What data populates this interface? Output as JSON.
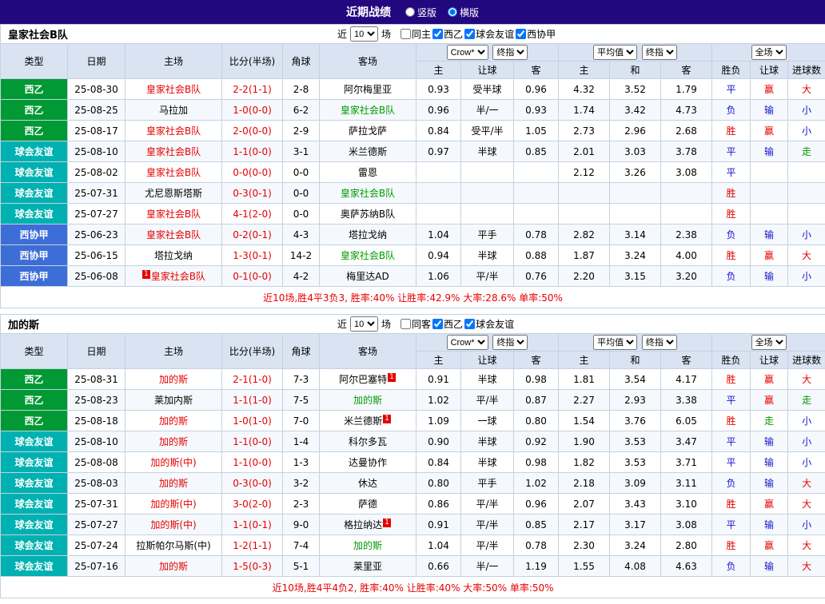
{
  "topbar": {
    "title": "近期战绩",
    "options": [
      {
        "label": "竖版",
        "selected": false
      },
      {
        "label": "横版",
        "selected": true
      }
    ]
  },
  "colors": {
    "topbar_bg": "#23077e",
    "header_bg": "#d9e3f2",
    "border": "#c4d2e0",
    "score_red": "#e60000",
    "result_blue": "#1414cc",
    "result_green": "#009900",
    "league": {
      "西乙": "#009933",
      "球会友谊": "#00b1b1",
      "西协甲": "#3d6dd6"
    }
  },
  "tables": [
    {
      "team": "皇家社会B队",
      "filter": {
        "prefix": "近",
        "count": "10",
        "suffix": "场",
        "checkboxes": [
          {
            "label": "同主",
            "checked": false
          },
          {
            "label": "西乙",
            "checked": true
          },
          {
            "label": "球会友谊",
            "checked": true
          },
          {
            "label": "西协甲",
            "checked": true
          }
        ]
      },
      "selects": {
        "bookmaker": "Crow*",
        "asia_time": "终指",
        "europe_avg": "平均值",
        "europe_time": "终指",
        "scope": "全场"
      },
      "columns": [
        "类型",
        "日期",
        "主场",
        "比分(半场)",
        "角球",
        "客场"
      ],
      "sub_columns": [
        "主",
        "让球",
        "客",
        "主",
        "和",
        "客",
        "胜负",
        "让球",
        "进球数"
      ],
      "rows": [
        {
          "league": "西乙",
          "date": "25-08-30",
          "home": {
            "name": "皇家社会B队",
            "cls": "c-red"
          },
          "score": "2-2(1-1)",
          "corners": "2-8",
          "away": {
            "name": "阿尔梅里亚",
            "cls": ""
          },
          "asia": [
            "0.93",
            "受半球",
            "0.96"
          ],
          "europe": [
            "4.32",
            "3.52",
            "1.79"
          ],
          "result": [
            [
              "平",
              "c-blue"
            ],
            [
              "赢",
              "c-red"
            ],
            [
              "大",
              "c-red"
            ]
          ]
        },
        {
          "league": "西乙",
          "date": "25-08-25",
          "home": {
            "name": "马拉加",
            "cls": ""
          },
          "score": "1-0(0-0)",
          "corners": "6-2",
          "away": {
            "name": "皇家社会B队",
            "cls": "c-green"
          },
          "asia": [
            "0.96",
            "半/一",
            "0.93"
          ],
          "europe": [
            "1.74",
            "3.42",
            "4.73"
          ],
          "result": [
            [
              "负",
              "c-blue"
            ],
            [
              "输",
              "c-blue"
            ],
            [
              "小",
              "c-blue"
            ]
          ]
        },
        {
          "league": "西乙",
          "date": "25-08-17",
          "home": {
            "name": "皇家社会B队",
            "cls": "c-red"
          },
          "score": "2-0(0-0)",
          "corners": "2-9",
          "away": {
            "name": "萨拉戈萨",
            "cls": ""
          },
          "asia": [
            "0.84",
            "受平/半",
            "1.05"
          ],
          "europe": [
            "2.73",
            "2.96",
            "2.68"
          ],
          "result": [
            [
              "胜",
              "c-red"
            ],
            [
              "赢",
              "c-red"
            ],
            [
              "小",
              "c-blue"
            ]
          ]
        },
        {
          "league": "球会友谊",
          "date": "25-08-10",
          "home": {
            "name": "皇家社会B队",
            "cls": "c-red"
          },
          "score": "1-1(0-0)",
          "corners": "3-1",
          "away": {
            "name": "米兰德斯",
            "cls": ""
          },
          "asia": [
            "0.97",
            "半球",
            "0.85"
          ],
          "europe": [
            "2.01",
            "3.03",
            "3.78"
          ],
          "result": [
            [
              "平",
              "c-blue"
            ],
            [
              "输",
              "c-blue"
            ],
            [
              "走",
              "c-green"
            ]
          ]
        },
        {
          "league": "球会友谊",
          "date": "25-08-02",
          "home": {
            "name": "皇家社会B队",
            "cls": "c-red"
          },
          "score": "0-0(0-0)",
          "corners": "0-0",
          "away": {
            "name": "雷恩",
            "cls": ""
          },
          "asia": [
            "",
            "",
            ""
          ],
          "europe": [
            "2.12",
            "3.26",
            "3.08"
          ],
          "result": [
            [
              "平",
              "c-blue"
            ],
            [
              "",
              ""
            ],
            [
              "",
              ""
            ]
          ]
        },
        {
          "league": "球会友谊",
          "date": "25-07-31",
          "home": {
            "name": "尤尼恩斯塔斯",
            "cls": ""
          },
          "score": "0-3(0-1)",
          "corners": "0-0",
          "away": {
            "name": "皇家社会B队",
            "cls": "c-green"
          },
          "asia": [
            "",
            "",
            ""
          ],
          "europe": [
            "",
            "",
            ""
          ],
          "result": [
            [
              "胜",
              "c-red"
            ],
            [
              "",
              ""
            ],
            [
              "",
              ""
            ]
          ]
        },
        {
          "league": "球会友谊",
          "date": "25-07-27",
          "home": {
            "name": "皇家社会B队",
            "cls": "c-red"
          },
          "score": "4-1(2-0)",
          "corners": "0-0",
          "away": {
            "name": "奥萨苏纳B队",
            "cls": ""
          },
          "asia": [
            "",
            "",
            ""
          ],
          "europe": [
            "",
            "",
            ""
          ],
          "result": [
            [
              "胜",
              "c-red"
            ],
            [
              "",
              ""
            ],
            [
              "",
              ""
            ]
          ]
        },
        {
          "league": "西协甲",
          "date": "25-06-23",
          "home": {
            "name": "皇家社会B队",
            "cls": "c-red"
          },
          "score": "0-2(0-1)",
          "corners": "4-3",
          "away": {
            "name": "塔拉戈纳",
            "cls": ""
          },
          "asia": [
            "1.04",
            "平手",
            "0.78"
          ],
          "europe": [
            "2.82",
            "3.14",
            "2.38"
          ],
          "result": [
            [
              "负",
              "c-blue"
            ],
            [
              "输",
              "c-blue"
            ],
            [
              "小",
              "c-blue"
            ]
          ]
        },
        {
          "league": "西协甲",
          "date": "25-06-15",
          "home": {
            "name": "塔拉戈纳",
            "cls": ""
          },
          "score": "1-3(0-1)",
          "corners": "14-2",
          "away": {
            "name": "皇家社会B队",
            "cls": "c-green"
          },
          "asia": [
            "0.94",
            "半球",
            "0.88"
          ],
          "europe": [
            "1.87",
            "3.24",
            "4.00"
          ],
          "result": [
            [
              "胜",
              "c-red"
            ],
            [
              "赢",
              "c-red"
            ],
            [
              "大",
              "c-red"
            ]
          ]
        },
        {
          "league": "西协甲",
          "date": "25-06-08",
          "home": {
            "name": "皇家社会B队",
            "cls": "c-red",
            "badge": "1",
            "badge_pos": "before"
          },
          "score": "0-1(0-0)",
          "corners": "4-2",
          "away": {
            "name": "梅里达AD",
            "cls": ""
          },
          "asia": [
            "1.06",
            "平/半",
            "0.76"
          ],
          "europe": [
            "2.20",
            "3.15",
            "3.20"
          ],
          "result": [
            [
              "负",
              "c-blue"
            ],
            [
              "输",
              "c-blue"
            ],
            [
              "小",
              "c-blue"
            ]
          ]
        }
      ],
      "summary": "近10场,胜4平3负3, 胜率:40% 让胜率:42.9% 大率:28.6% 单率:50%"
    },
    {
      "team": "加的斯",
      "filter": {
        "prefix": "近",
        "count": "10",
        "suffix": "场",
        "checkboxes": [
          {
            "label": "同客",
            "checked": false
          },
          {
            "label": "西乙",
            "checked": true
          },
          {
            "label": "球会友谊",
            "checked": true
          }
        ]
      },
      "selects": {
        "bookmaker": "Crow*",
        "asia_time": "终指",
        "europe_avg": "平均值",
        "europe_time": "终指",
        "scope": "全场"
      },
      "columns": [
        "类型",
        "日期",
        "主场",
        "比分(半场)",
        "角球",
        "客场"
      ],
      "sub_columns": [
        "主",
        "让球",
        "客",
        "主",
        "和",
        "客",
        "胜负",
        "让球",
        "进球数"
      ],
      "rows": [
        {
          "league": "西乙",
          "date": "25-08-31",
          "home": {
            "name": "加的斯",
            "cls": "c-red"
          },
          "score": "2-1(1-0)",
          "corners": "7-3",
          "away": {
            "name": "阿尔巴塞特",
            "cls": "",
            "badge": "1",
            "badge_pos": "after"
          },
          "asia": [
            "0.91",
            "半球",
            "0.98"
          ],
          "europe": [
            "1.81",
            "3.54",
            "4.17"
          ],
          "result": [
            [
              "胜",
              "c-red"
            ],
            [
              "赢",
              "c-red"
            ],
            [
              "大",
              "c-red"
            ]
          ]
        },
        {
          "league": "西乙",
          "date": "25-08-23",
          "home": {
            "name": "莱加内斯",
            "cls": ""
          },
          "score": "1-1(1-0)",
          "corners": "7-5",
          "away": {
            "name": "加的斯",
            "cls": "c-green"
          },
          "asia": [
            "1.02",
            "平/半",
            "0.87"
          ],
          "europe": [
            "2.27",
            "2.93",
            "3.38"
          ],
          "result": [
            [
              "平",
              "c-blue"
            ],
            [
              "赢",
              "c-red"
            ],
            [
              "走",
              "c-green"
            ]
          ]
        },
        {
          "league": "西乙",
          "date": "25-08-18",
          "home": {
            "name": "加的斯",
            "cls": "c-red"
          },
          "score": "1-0(1-0)",
          "corners": "7-0",
          "away": {
            "name": "米兰德斯",
            "cls": "",
            "badge": "1",
            "badge_pos": "after"
          },
          "asia": [
            "1.09",
            "一球",
            "0.80"
          ],
          "europe": [
            "1.54",
            "3.76",
            "6.05"
          ],
          "result": [
            [
              "胜",
              "c-red"
            ],
            [
              "走",
              "c-green"
            ],
            [
              "小",
              "c-blue"
            ]
          ]
        },
        {
          "league": "球会友谊",
          "date": "25-08-10",
          "home": {
            "name": "加的斯",
            "cls": "c-red"
          },
          "score": "1-1(0-0)",
          "corners": "1-4",
          "away": {
            "name": "科尔多瓦",
            "cls": ""
          },
          "asia": [
            "0.90",
            "半球",
            "0.92"
          ],
          "europe": [
            "1.90",
            "3.53",
            "3.47"
          ],
          "result": [
            [
              "平",
              "c-blue"
            ],
            [
              "输",
              "c-blue"
            ],
            [
              "小",
              "c-blue"
            ]
          ]
        },
        {
          "league": "球会友谊",
          "date": "25-08-08",
          "home": {
            "name": "加的斯(中)",
            "cls": "c-red"
          },
          "score": "1-1(0-0)",
          "corners": "1-3",
          "away": {
            "name": "达曼协作",
            "cls": ""
          },
          "asia": [
            "0.84",
            "半球",
            "0.98"
          ],
          "europe": [
            "1.82",
            "3.53",
            "3.71"
          ],
          "result": [
            [
              "平",
              "c-blue"
            ],
            [
              "输",
              "c-blue"
            ],
            [
              "小",
              "c-blue"
            ]
          ]
        },
        {
          "league": "球会友谊",
          "date": "25-08-03",
          "home": {
            "name": "加的斯",
            "cls": "c-red"
          },
          "score": "0-3(0-0)",
          "corners": "3-2",
          "away": {
            "name": "休达",
            "cls": ""
          },
          "asia": [
            "0.80",
            "平手",
            "1.02"
          ],
          "europe": [
            "2.18",
            "3.09",
            "3.11"
          ],
          "result": [
            [
              "负",
              "c-blue"
            ],
            [
              "输",
              "c-blue"
            ],
            [
              "大",
              "c-red"
            ]
          ]
        },
        {
          "league": "球会友谊",
          "date": "25-07-31",
          "home": {
            "name": "加的斯(中)",
            "cls": "c-red"
          },
          "score": "3-0(2-0)",
          "corners": "2-3",
          "away": {
            "name": "萨德",
            "cls": ""
          },
          "asia": [
            "0.86",
            "平/半",
            "0.96"
          ],
          "europe": [
            "2.07",
            "3.43",
            "3.10"
          ],
          "result": [
            [
              "胜",
              "c-red"
            ],
            [
              "赢",
              "c-red"
            ],
            [
              "大",
              "c-red"
            ]
          ]
        },
        {
          "league": "球会友谊",
          "date": "25-07-27",
          "home": {
            "name": "加的斯(中)",
            "cls": "c-red"
          },
          "score": "1-1(0-1)",
          "corners": "9-0",
          "away": {
            "name": "格拉纳达",
            "cls": "",
            "badge": "1",
            "badge_pos": "after"
          },
          "asia": [
            "0.91",
            "平/半",
            "0.85"
          ],
          "europe": [
            "2.17",
            "3.17",
            "3.08"
          ],
          "result": [
            [
              "平",
              "c-blue"
            ],
            [
              "输",
              "c-blue"
            ],
            [
              "小",
              "c-blue"
            ]
          ]
        },
        {
          "league": "球会友谊",
          "date": "25-07-24",
          "home": {
            "name": "拉斯帕尔马斯(中)",
            "cls": ""
          },
          "score": "1-2(1-1)",
          "corners": "7-4",
          "away": {
            "name": "加的斯",
            "cls": "c-green"
          },
          "asia": [
            "1.04",
            "平/半",
            "0.78"
          ],
          "europe": [
            "2.30",
            "3.24",
            "2.80"
          ],
          "result": [
            [
              "胜",
              "c-red"
            ],
            [
              "赢",
              "c-red"
            ],
            [
              "大",
              "c-red"
            ]
          ]
        },
        {
          "league": "球会友谊",
          "date": "25-07-16",
          "home": {
            "name": "加的斯",
            "cls": "c-red"
          },
          "score": "1-5(0-3)",
          "corners": "5-1",
          "away": {
            "name": "莱里亚",
            "cls": ""
          },
          "asia": [
            "0.66",
            "半/一",
            "1.19"
          ],
          "europe": [
            "1.55",
            "4.08",
            "4.63"
          ],
          "result": [
            [
              "负",
              "c-blue"
            ],
            [
              "输",
              "c-blue"
            ],
            [
              "大",
              "c-red"
            ]
          ]
        }
      ],
      "summary": "近10场,胜4平4负2, 胜率:40% 让胜率:40% 大率:50% 单率:50%"
    }
  ]
}
